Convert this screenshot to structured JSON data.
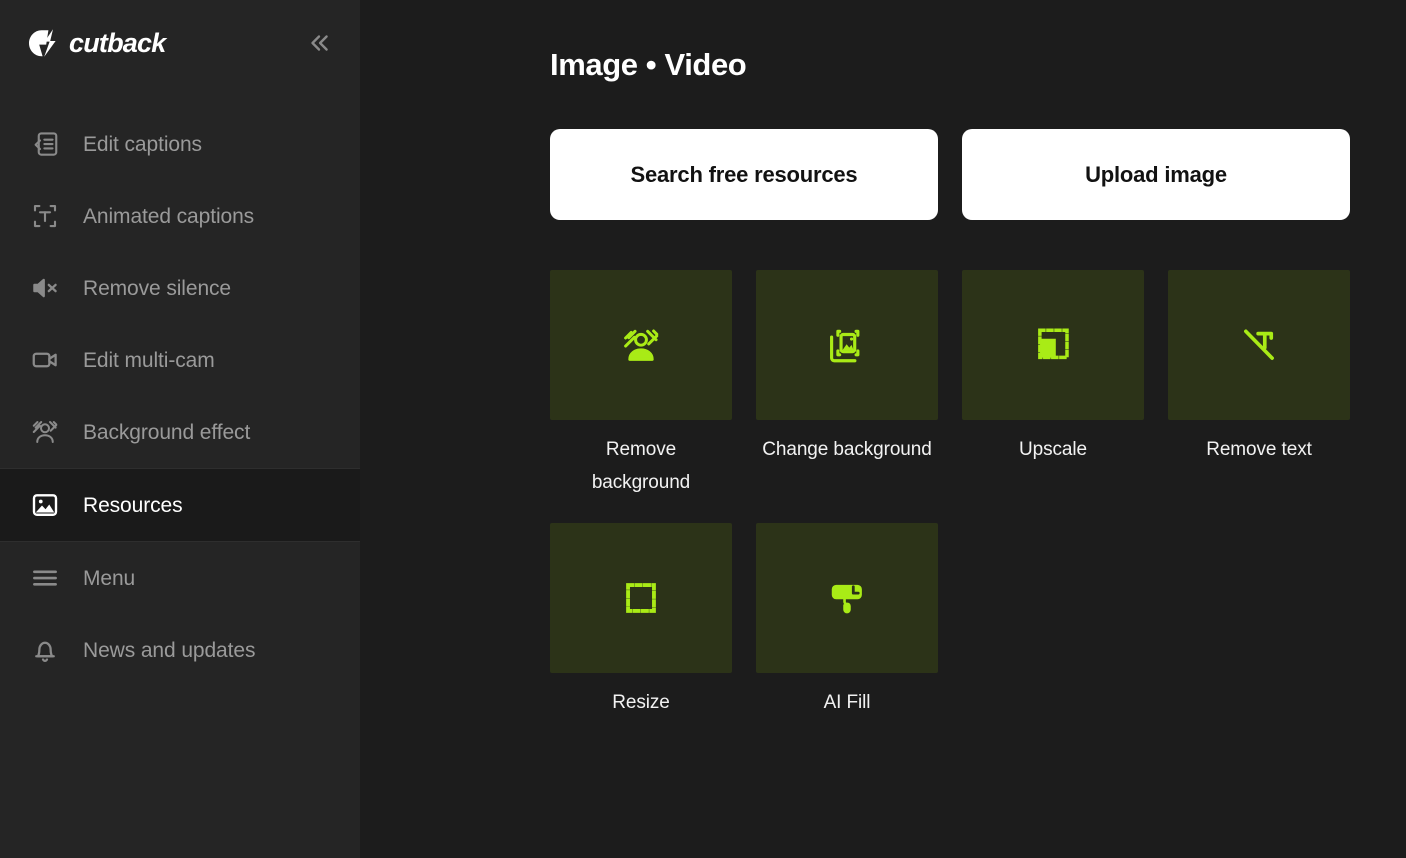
{
  "sidebar": {
    "brand": {
      "name": "cutback",
      "logo_icon": "lightning-bolt-icon"
    },
    "collapse_label": "«",
    "items": [
      {
        "label": "Edit captions",
        "icon": "edit-captions-icon",
        "active": false
      },
      {
        "label": "Animated captions",
        "icon": "animated-captions-icon",
        "active": false
      },
      {
        "label": "Remove silence",
        "icon": "mute-speaker-icon",
        "active": false
      },
      {
        "label": "Edit multi-cam",
        "icon": "video-camera-icon",
        "active": false
      },
      {
        "label": "Background effect",
        "icon": "background-effect-icon",
        "active": false
      },
      {
        "label": "Resources",
        "icon": "image-icon",
        "active": true
      },
      {
        "label": "Menu",
        "icon": "hamburger-menu-icon",
        "active": false
      },
      {
        "label": "News and updates",
        "icon": "bell-icon",
        "active": false
      }
    ]
  },
  "main": {
    "title": "Image • Video",
    "actions": [
      {
        "label": "Search free resources"
      },
      {
        "label": "Upload image"
      }
    ],
    "tools": [
      {
        "label": "Remove background",
        "icon": "remove-background-icon"
      },
      {
        "label": "Change background",
        "icon": "change-background-icon"
      },
      {
        "label": "Upscale",
        "icon": "upscale-icon"
      },
      {
        "label": "Remove text",
        "icon": "remove-text-icon"
      },
      {
        "label": "Resize",
        "icon": "resize-icon"
      },
      {
        "label": "AI Fill",
        "icon": "ai-fill-icon"
      }
    ]
  },
  "colors": {
    "app_background": "#1c1c1c",
    "sidebar_background": "#252525",
    "active_item_background": "#1a1a1a",
    "card_background": "#2c3318",
    "accent_green": "#a9eb16",
    "button_background": "#ffffff",
    "text_primary": "#ffffff",
    "text_muted": "#9a9a9a"
  }
}
